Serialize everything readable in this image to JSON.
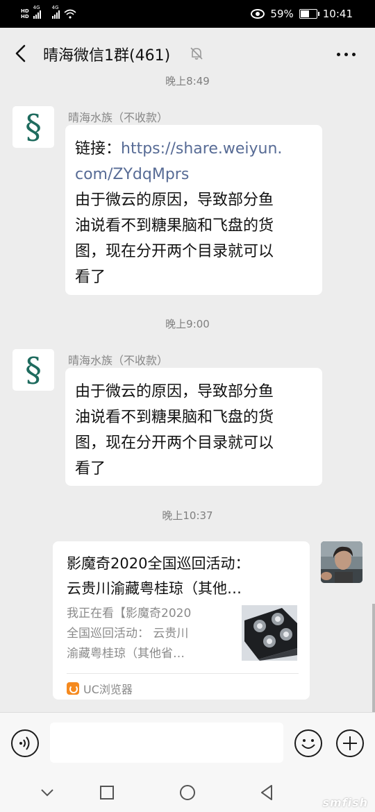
{
  "status_bar": {
    "network_1": "4G",
    "network_2": "4G",
    "battery": "59%",
    "battery_level": 0.59,
    "time": "10:41"
  },
  "header": {
    "title": "晴海微信1群(461)",
    "back_icon": "chevron-left-icon",
    "mute_icon": "bell-muted-icon",
    "more_icon": "ellipsis-icon"
  },
  "messages": [
    {
      "type": "time",
      "text": "晚上8:49"
    },
    {
      "type": "text",
      "sender": "晴海水族（不收款）",
      "avatar_glyph": "§",
      "link_label": "链接：",
      "link_line1": "https://share.weiyun.",
      "link_line2": "com/ZYdqMprs",
      "lines": [
        "由于微云的原因，导致部分鱼",
        "油说看不到糖果脑和飞盘的货",
        "图，现在分开两个目录就可以",
        "看了"
      ]
    },
    {
      "type": "time",
      "text": "晚上9:00"
    },
    {
      "type": "text",
      "sender": "晴海水族（不收款）",
      "avatar_glyph": "§",
      "lines": [
        "由于微云的原因，导致部分鱼",
        "油说看不到糖果脑和飞盘的货",
        "图，现在分开两个目录就可以",
        "看了"
      ]
    },
    {
      "type": "time",
      "text": "晚上10:37"
    },
    {
      "type": "link_card",
      "title_lines": [
        "影魔奇2020全国巡回活动：",
        "云贵川渝藏粤桂琼（其他…"
      ],
      "desc_lines": [
        "我正在看【影魔奇2020",
        "全国巡回活动： 云贵川",
        "渝藏粤桂琼（其他省…"
      ],
      "source": "UC浏览器"
    }
  ],
  "input_bar": {
    "voice_icon": "voice-icon",
    "emoji_icon": "smiley-icon",
    "plus_icon": "plus-icon"
  },
  "watermark": "smfish"
}
